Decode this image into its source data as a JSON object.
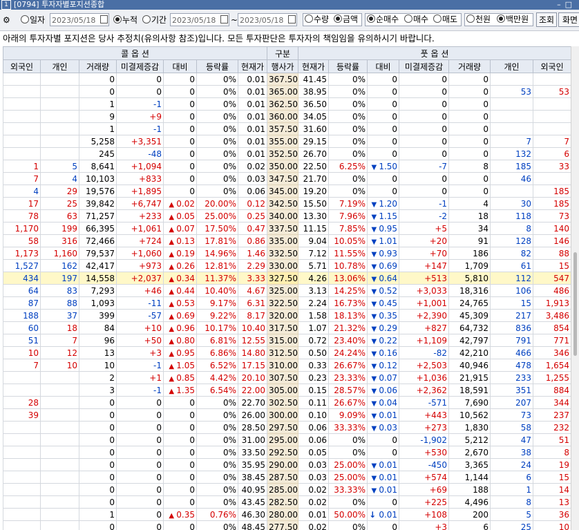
{
  "window": {
    "num": "1",
    "title": "[0794] 투자자별포지션종합"
  },
  "toolbar": {
    "r_day": "일자",
    "date1": "2023/05/18",
    "r_cum": "누적",
    "r_period": "기간",
    "date2": "2023/05/18",
    "tilde": "~",
    "date3": "2023/05/18",
    "r_qty": "수량",
    "r_amt": "금액",
    "r_net": "순매수",
    "r_buy": "매수",
    "r_sell": "매도",
    "r_krw1": "천원",
    "r_krw2": "백만원",
    "query": "조회",
    "screen": "화면"
  },
  "notice": "아래의 투자자별 포지션은 당사 추정치(유의사항 참조)입니다. 모든 투자판단은 투자자의 책임임을 유의하시기 바랍니다.",
  "header": {
    "call": "콜 옵 션",
    "kind": "구분",
    "put": "풋 옵 션",
    "cols": [
      "외국인",
      "개인",
      "거래량",
      "미결제증감",
      "대비",
      "등락률",
      "현재가",
      "행사가",
      "현재가",
      "등락률",
      "대비",
      "미결제증감",
      "거래량",
      "개인",
      "외국인"
    ]
  },
  "rows": [
    [
      "",
      "",
      "0",
      "0",
      "0",
      "0%",
      "0.01",
      "367.50",
      "41.45",
      "0%",
      "0",
      "0",
      "0",
      "",
      ""
    ],
    [
      "",
      "",
      "0",
      "0",
      "0",
      "0%",
      "0.01",
      "365.00",
      "38.95",
      "0%",
      "0",
      "0",
      "0",
      "53",
      "53"
    ],
    [
      "",
      "",
      "1",
      "-1",
      "0",
      "0%",
      "0.01",
      "362.50",
      "36.50",
      "0%",
      "0",
      "0",
      "0",
      "",
      ""
    ],
    [
      "",
      "",
      "9",
      "+9",
      "0",
      "0%",
      "0.01",
      "360.00",
      "34.05",
      "0%",
      "0",
      "0",
      "0",
      "",
      ""
    ],
    [
      "",
      "",
      "1",
      "-1",
      "0",
      "0%",
      "0.01",
      "357.50",
      "31.60",
      "0%",
      "0",
      "0",
      "0",
      "",
      ""
    ],
    [
      "",
      "",
      "5,258",
      "+3,351",
      "0",
      "0%",
      "0.01",
      "355.00",
      "29.15",
      "0%",
      "0",
      "0",
      "0",
      "7",
      "7"
    ],
    [
      "",
      "",
      "245",
      "-48",
      "0",
      "0%",
      "0.01",
      "352.50",
      "26.70",
      "0%",
      "0",
      "0",
      "0",
      "132",
      "6"
    ],
    [
      "1",
      "5",
      "8,641",
      "+1,094",
      "0",
      "0%",
      "0.02",
      "350.00",
      "22.50",
      "6.25%",
      "1.50",
      "-7",
      "8",
      "185",
      "33"
    ],
    [
      "7",
      "4",
      "10,103",
      "+833",
      "0",
      "0%",
      "0.03",
      "347.50",
      "21.70",
      "0%",
      "0",
      "0",
      "0",
      "46",
      ""
    ],
    [
      "4",
      "29",
      "19,576",
      "+1,895",
      "0",
      "0%",
      "0.06",
      "345.00",
      "19.20",
      "0%",
      "0",
      "0",
      "0",
      "",
      "185"
    ],
    [
      "17",
      "25",
      "39,842",
      "+6,747",
      "0.02",
      "20.00%",
      "0.12",
      "342.50",
      "15.50",
      "7.19%",
      "1.20",
      "-1",
      "4",
      "30",
      "185"
    ],
    [
      "78",
      "63",
      "71,257",
      "+233",
      "0.05",
      "25.00%",
      "0.25",
      "340.00",
      "13.30",
      "7.96%",
      "1.15",
      "-2",
      "18",
      "118",
      "73"
    ],
    [
      "1,170",
      "199",
      "66,395",
      "+1,061",
      "0.07",
      "17.50%",
      "0.47",
      "337.50",
      "11.15",
      "7.85%",
      "0.95",
      "+5",
      "34",
      "8",
      "140"
    ],
    [
      "58",
      "316",
      "72,466",
      "+724",
      "0.13",
      "17.81%",
      "0.86",
      "335.00",
      "9.04",
      "10.05%",
      "1.01",
      "+20",
      "91",
      "128",
      "146"
    ],
    [
      "1,173",
      "1,160",
      "79,537",
      "+1,060",
      "0.19",
      "14.96%",
      "1.46",
      "332.50",
      "7.12",
      "11.55%",
      "0.93",
      "+70",
      "186",
      "82",
      "88"
    ],
    [
      "1,527",
      "162",
      "42,417",
      "+973",
      "0.26",
      "12.81%",
      "2.29",
      "330.00",
      "5.71",
      "10.78%",
      "0.69",
      "+147",
      "1,709",
      "61",
      "15"
    ],
    [
      "434",
      "197",
      "14,558",
      "+2,037",
      "0.34",
      "11.37%",
      "3.33",
      "327.50",
      "4.26",
      "13.06%",
      "0.64",
      "+513",
      "5,810",
      "112",
      "547"
    ],
    [
      "64",
      "83",
      "7,293",
      "+46",
      "0.44",
      "10.40%",
      "4.67",
      "325.00",
      "3.13",
      "14.25%",
      "0.52",
      "+3,033",
      "18,316",
      "106",
      "486"
    ],
    [
      "87",
      "88",
      "1,093",
      "-11",
      "0.53",
      "9.17%",
      "6.31",
      "322.50",
      "2.24",
      "16.73%",
      "0.45",
      "+1,001",
      "24,765",
      "15",
      "1,913"
    ],
    [
      "188",
      "37",
      "399",
      "-57",
      "0.69",
      "9.22%",
      "8.17",
      "320.00",
      "1.58",
      "18.13%",
      "0.35",
      "+2,390",
      "45,309",
      "217",
      "3,486"
    ],
    [
      "60",
      "18",
      "84",
      "+10",
      "0.96",
      "10.17%",
      "10.40",
      "317.50",
      "1.07",
      "21.32%",
      "0.29",
      "+827",
      "64,732",
      "836",
      "854"
    ],
    [
      "51",
      "7",
      "96",
      "+50",
      "0.80",
      "6.81%",
      "12.55",
      "315.00",
      "0.72",
      "23.40%",
      "0.22",
      "+1,109",
      "42,797",
      "791",
      "771"
    ],
    [
      "10",
      "12",
      "13",
      "+3",
      "0.95",
      "6.86%",
      "14.80",
      "312.50",
      "0.50",
      "24.24%",
      "0.16",
      "-82",
      "42,210",
      "466",
      "346"
    ],
    [
      "7",
      "10",
      "10",
      "-1",
      "1.05",
      "6.52%",
      "17.15",
      "310.00",
      "0.33",
      "26.67%",
      "0.12",
      "+2,503",
      "40,946",
      "478",
      "1,654"
    ],
    [
      "",
      "",
      "2",
      "+1",
      "0.85",
      "4.42%",
      "20.10",
      "307.50",
      "0.23",
      "23.33%",
      "0.07",
      "+1,036",
      "21,915",
      "233",
      "1,255"
    ],
    [
      "",
      "",
      "3",
      "-1",
      "1.35",
      "6.54%",
      "22.00",
      "305.00",
      "0.15",
      "28.57%",
      "0.06",
      "+2,362",
      "18,591",
      "351",
      "884"
    ],
    [
      "28",
      "",
      "0",
      "0",
      "0",
      "0%",
      "22.70",
      "302.50",
      "0.11",
      "26.67%",
      "0.04",
      "-571",
      "7,690",
      "207",
      "344"
    ],
    [
      "39",
      "",
      "0",
      "0",
      "0",
      "0%",
      "26.00",
      "300.00",
      "0.10",
      "9.09%",
      "0.01",
      "+443",
      "10,562",
      "73",
      "237"
    ],
    [
      "",
      "",
      "0",
      "0",
      "0",
      "0%",
      "28.50",
      "297.50",
      "0.06",
      "33.33%",
      "0.03",
      "+273",
      "1,830",
      "58",
      "232"
    ],
    [
      "",
      "",
      "0",
      "0",
      "0",
      "0%",
      "31.00",
      "295.00",
      "0.06",
      "0%",
      "0",
      "-1,902",
      "5,212",
      "47",
      "51"
    ],
    [
      "",
      "",
      "0",
      "0",
      "0",
      "0%",
      "33.50",
      "292.50",
      "0.05",
      "0%",
      "0",
      "+530",
      "2,670",
      "38",
      "8"
    ],
    [
      "",
      "",
      "0",
      "0",
      "0",
      "0%",
      "35.95",
      "290.00",
      "0.03",
      "25.00%",
      "0.01",
      "-450",
      "3,365",
      "24",
      "19"
    ],
    [
      "",
      "",
      "0",
      "0",
      "0",
      "0%",
      "38.45",
      "287.50",
      "0.03",
      "25.00%",
      "0.01",
      "+574",
      "1,144",
      "6",
      "15"
    ],
    [
      "",
      "",
      "0",
      "0",
      "0",
      "0%",
      "40.95",
      "285.00",
      "0.02",
      "33.33%",
      "0.01",
      "+69",
      "188",
      "1",
      "14"
    ],
    [
      "",
      "",
      "0",
      "0",
      "0",
      "0%",
      "43.45",
      "282.50",
      "0.02",
      "0%",
      "0",
      "+225",
      "4,496",
      "8",
      "13"
    ],
    [
      "",
      "",
      "1",
      "0",
      "0.35",
      "0.76%",
      "46.30",
      "280.00",
      "0.01",
      "50.00%",
      "0.01",
      "+108",
      "200",
      "5",
      "36"
    ],
    [
      "",
      "",
      "0",
      "0",
      "0",
      "0%",
      "48.45",
      "277.50",
      "0.02",
      "0%",
      "0",
      "+3",
      "6",
      "25",
      "10"
    ]
  ],
  "colors": {
    "up": "#d40000",
    "down": "#0040c0",
    "strike_bg": "#f3ead7",
    "selected_bg": "#fff8c8",
    "header_bg": "#e6ebf3"
  }
}
